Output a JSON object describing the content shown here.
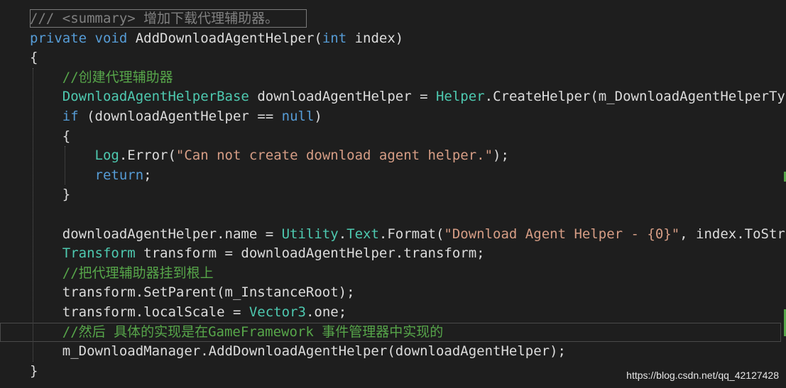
{
  "editor": {
    "lines": [
      [
        {
          "t": "/// <summary> 增加下载代理辅助器。",
          "c": "doc"
        }
      ],
      [
        {
          "t": "private",
          "c": "kw"
        },
        {
          "t": " ",
          "c": "plain"
        },
        {
          "t": "void",
          "c": "kw"
        },
        {
          "t": " AddDownloadAgentHelper(",
          "c": "plain"
        },
        {
          "t": "int",
          "c": "kw"
        },
        {
          "t": " index)",
          "c": "plain"
        }
      ],
      [
        {
          "t": "{",
          "c": "plain"
        }
      ],
      [
        {
          "t": "    //创建代理辅助器",
          "c": "cm"
        }
      ],
      [
        {
          "t": "    ",
          "c": "plain"
        },
        {
          "t": "DownloadAgentHelperBase",
          "c": "type"
        },
        {
          "t": " downloadAgentHelper = ",
          "c": "plain"
        },
        {
          "t": "Helper",
          "c": "type"
        },
        {
          "t": ".CreateHelper(m_DownloadAgentHelperType",
          "c": "plain"
        }
      ],
      [
        {
          "t": "    ",
          "c": "plain"
        },
        {
          "t": "if",
          "c": "kw"
        },
        {
          "t": " (downloadAgentHelper == ",
          "c": "plain"
        },
        {
          "t": "null",
          "c": "kw"
        },
        {
          "t": ")",
          "c": "plain"
        }
      ],
      [
        {
          "t": "    {",
          "c": "plain"
        }
      ],
      [
        {
          "t": "        ",
          "c": "plain"
        },
        {
          "t": "Log",
          "c": "type"
        },
        {
          "t": ".Error(",
          "c": "plain"
        },
        {
          "t": "\"Can not create download agent helper.\"",
          "c": "str"
        },
        {
          "t": ");",
          "c": "plain"
        }
      ],
      [
        {
          "t": "        ",
          "c": "plain"
        },
        {
          "t": "return",
          "c": "kw"
        },
        {
          "t": ";",
          "c": "plain"
        }
      ],
      [
        {
          "t": "    }",
          "c": "plain"
        }
      ],
      [],
      [
        {
          "t": "    downloadAgentHelper.name = ",
          "c": "plain"
        },
        {
          "t": "Utility",
          "c": "type"
        },
        {
          "t": ".",
          "c": "plain"
        },
        {
          "t": "Text",
          "c": "type"
        },
        {
          "t": ".Format(",
          "c": "plain"
        },
        {
          "t": "\"Download Agent Helper - {0}\"",
          "c": "str"
        },
        {
          "t": ", index.ToStrin",
          "c": "plain"
        }
      ],
      [
        {
          "t": "    ",
          "c": "plain"
        },
        {
          "t": "Transform",
          "c": "type"
        },
        {
          "t": " transform = downloadAgentHelper.transform;",
          "c": "plain"
        }
      ],
      [
        {
          "t": "    //把代理辅助器挂到根上",
          "c": "cm"
        }
      ],
      [
        {
          "t": "    transform.SetParent(m_InstanceRoot);",
          "c": "plain"
        }
      ],
      [
        {
          "t": "    transform.localScale = ",
          "c": "plain"
        },
        {
          "t": "Vector3",
          "c": "type"
        },
        {
          "t": ".one;",
          "c": "plain"
        }
      ],
      [
        {
          "t": "    //然后 具体的实现是在GameFramework 事件管理器中实现的",
          "c": "cm"
        }
      ],
      [
        {
          "t": "    m_DownloadManager.AddDownloadAgentHelper(downloadAgentHelper);",
          "c": "plain"
        }
      ],
      [
        {
          "t": "}",
          "c": "plain"
        }
      ]
    ],
    "colors": {
      "background": "#1e1e1e",
      "keyword": "#569cd6",
      "type": "#4ec9b0",
      "comment": "#57a64a",
      "doc_comment": "#808080",
      "string": "#d69d85",
      "text": "#dcdcdc"
    }
  },
  "watermark": "https://blog.csdn.net/qq_42127428"
}
